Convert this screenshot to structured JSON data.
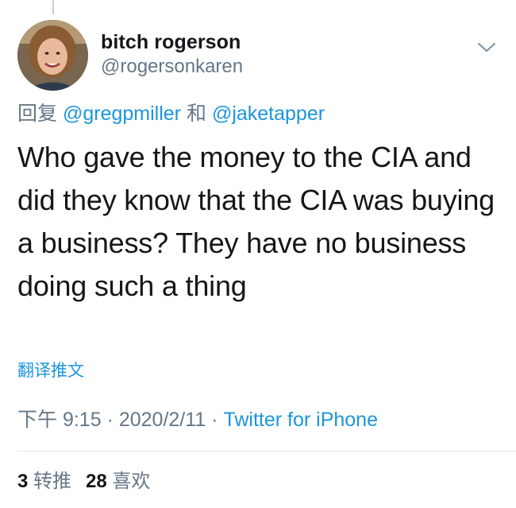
{
  "tweet": {
    "display_name": "bitch rogerson",
    "handle": "@rogersonkaren",
    "reply_prefix": "回复",
    "reply_mention_1": "@gregpmiller",
    "reply_joiner": "和",
    "reply_mention_2": "@jaketapper",
    "text": "Who gave the money to the CIA and did they know that the CIA was buying a business? They have no business doing such a thing",
    "translate_label": "翻译推文",
    "time": "下午 9:15",
    "separator": "·",
    "date": "2020/2/11",
    "source": "Twitter for iPhone",
    "retweet_count": "3",
    "retweet_label": "转推",
    "like_count": "28",
    "like_label": "喜欢"
  },
  "icons": {
    "menu": "chevron-down-icon",
    "avatar": "profile-photo"
  },
  "colors": {
    "text_primary": "#14171a",
    "text_secondary": "#657786",
    "link": "#1b95e0",
    "divider": "#e1e8ed"
  }
}
